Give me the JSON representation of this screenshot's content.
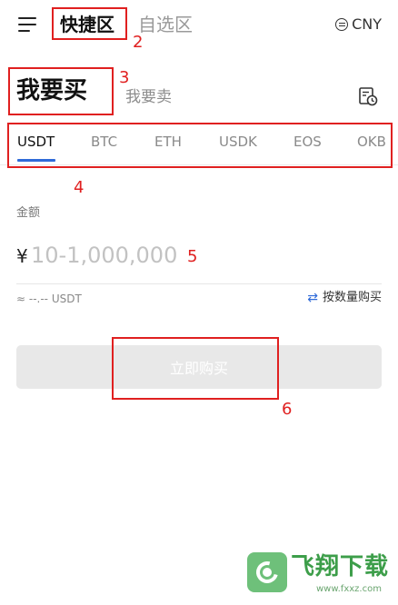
{
  "header": {
    "tabs": [
      {
        "label": "快捷区",
        "active": true
      },
      {
        "label": "自选区",
        "active": false
      }
    ],
    "currency": "CNY"
  },
  "trade_tabs": [
    {
      "label": "我要买",
      "active": true
    },
    {
      "label": "我要卖",
      "active": false
    }
  ],
  "coin_tabs": [
    {
      "label": "USDT",
      "active": true
    },
    {
      "label": "BTC",
      "active": false
    },
    {
      "label": "ETH",
      "active": false
    },
    {
      "label": "USDK",
      "active": false
    },
    {
      "label": "EOS",
      "active": false
    },
    {
      "label": "OKB",
      "active": false
    }
  ],
  "amount": {
    "label": "金额",
    "currency_symbol": "¥",
    "placeholder": "10-1,000,000",
    "value": "",
    "estimate": "≈ --.-- USDT",
    "switch_label": "按数量购买"
  },
  "buy_button": {
    "label": "立即购买",
    "enabled": false
  },
  "annotations": [
    "2",
    "3",
    "4",
    "5",
    "6"
  ],
  "watermark": {
    "text": "飞翔下载",
    "sub": "www.fxxz.com"
  },
  "colors": {
    "accent": "#2f6ad8",
    "annotation": "#e02020",
    "button_disabled": "#e8e8e8"
  }
}
